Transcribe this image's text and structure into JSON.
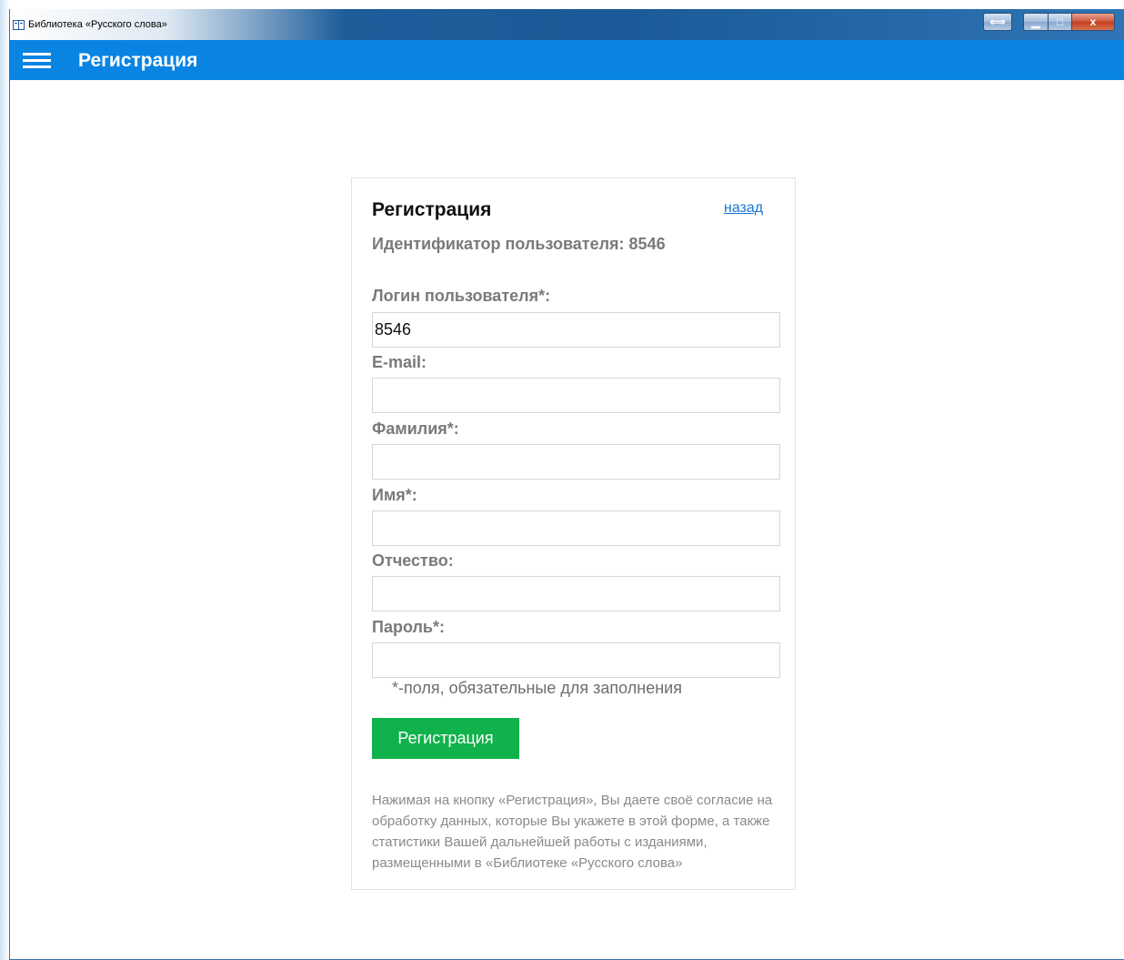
{
  "window": {
    "title": "Библиотека «Русского слова»",
    "buttons": {
      "restore_glyph": "⟺",
      "minimize_glyph": "▁",
      "maximize_glyph": "□",
      "close_glyph": "x"
    }
  },
  "appbar": {
    "title": "Регистрация",
    "menu_icon": "hamburger-menu-icon",
    "background": "#0a84e3"
  },
  "form": {
    "title": "Регистрация",
    "back_link": "назад",
    "user_id_text": "Идентификатор пользователя: 8546",
    "fields": [
      {
        "label": "Логин пользователя*:",
        "value": "8546"
      },
      {
        "label": "E-mail:",
        "value": ""
      },
      {
        "label": "Фамилия*:",
        "value": ""
      },
      {
        "label": "Имя*:",
        "value": ""
      },
      {
        "label": "Отчество:",
        "value": ""
      },
      {
        "label": "Пароль*:",
        "value": ""
      }
    ],
    "required_note": "*-поля, обязательные для заполнения",
    "submit_label": "Регистрация",
    "submit_color": "#10b24b",
    "consent_text": "Нажимая на кнопку «Регистрация», Вы даете своё согласие на обработку данных, которые Вы укажете в этой форме, а также статистики Вашей дальнейшей работы с изданиями, размещенными в «Библиотеке «Русского слова»"
  }
}
